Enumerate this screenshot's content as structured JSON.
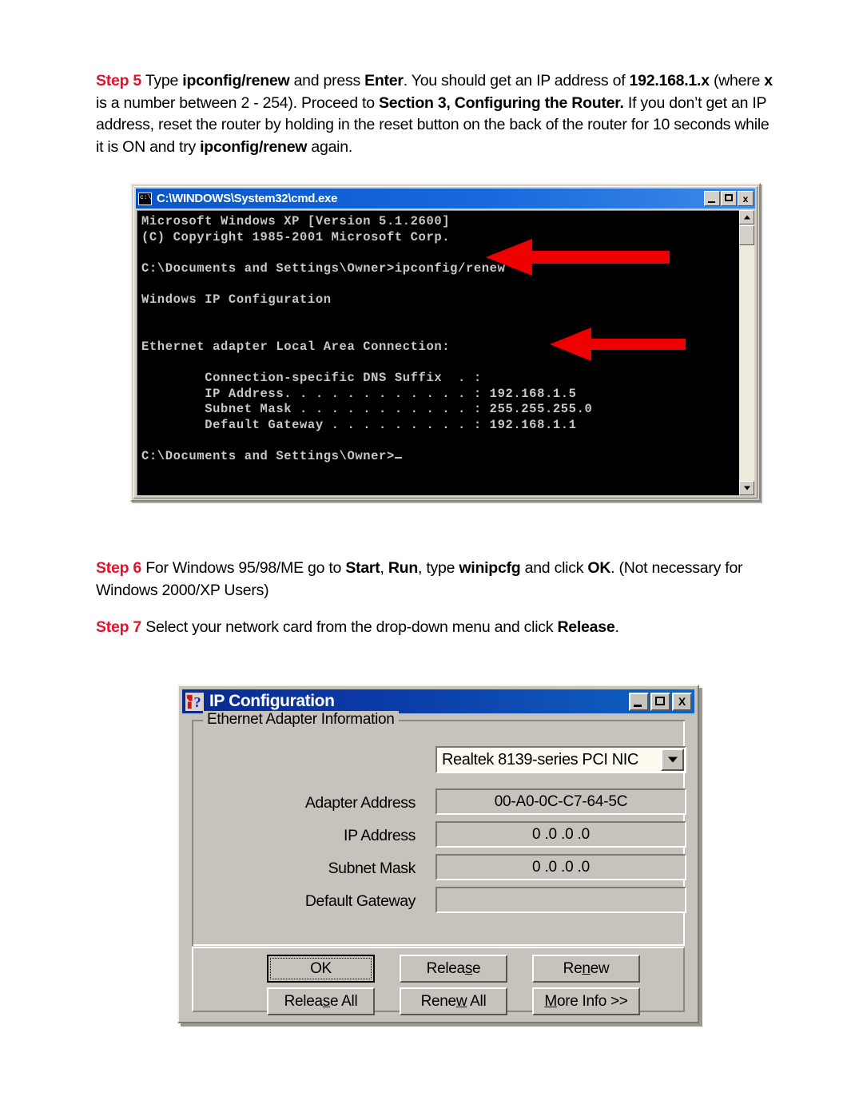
{
  "document": {
    "step5": {
      "label": "Step 5",
      "parts": [
        {
          "t": " Type ",
          "b": false
        },
        {
          "t": "ipconfig/renew",
          "b": true
        },
        {
          "t": " and press ",
          "b": false
        },
        {
          "t": "Enter",
          "b": true
        },
        {
          "t": ". You should get an IP address of ",
          "b": false
        },
        {
          "t": "192.168.1.x",
          "b": true
        },
        {
          "t": " (where ",
          "b": false
        },
        {
          "t": "x",
          "b": true
        },
        {
          "t": " is a number between 2 - 254). Proceed to ",
          "b": false
        },
        {
          "t": "Section 3, Configuring the Router.",
          "b": true
        },
        {
          "t": " If you don’t get an IP address, reset the router by holding in the reset button on the back of the router for 10 seconds while it is ON and try ",
          "b": false
        },
        {
          "t": "ipconfig/renew",
          "b": true
        },
        {
          "t": " again.",
          "b": false
        }
      ]
    },
    "step6": {
      "label": "Step 6",
      "parts": [
        {
          "t": " For Windows 95/98/ME go to ",
          "b": false
        },
        {
          "t": "Start",
          "b": true
        },
        {
          "t": ", ",
          "b": false
        },
        {
          "t": "Run",
          "b": true
        },
        {
          "t": ", type ",
          "b": false
        },
        {
          "t": "winipcfg",
          "b": true
        },
        {
          "t": " and click ",
          "b": false
        },
        {
          "t": "OK",
          "b": true
        },
        {
          "t": ".  (Not necessary for Windows 2000/XP Users)",
          "b": false
        }
      ]
    },
    "step7": {
      "label": "Step 7",
      "parts": [
        {
          "t": " Select your network card from the drop-down menu and click ",
          "b": false
        },
        {
          "t": "Release",
          "b": true
        },
        {
          "t": ".",
          "b": false
        }
      ]
    },
    "step_label_color": "#e8112d"
  },
  "cmd_window": {
    "title": "C:\\WINDOWS\\System32\\cmd.exe",
    "icon": "console-icon",
    "titlebar_color": "#1668dc",
    "screen_bg": "#000000",
    "screen_fg": "#c8c8c8",
    "buttons": {
      "minimize": "_",
      "maximize": "□",
      "close": "x"
    },
    "console_lines": [
      "Microsoft Windows XP [Version 5.1.2600]",
      "(C) Copyright 1985-2001 Microsoft Corp.",
      "",
      "C:\\Documents and Settings\\Owner>ipconfig/renew",
      "",
      "Windows IP Configuration",
      "",
      "",
      "Ethernet adapter Local Area Connection:",
      "",
      "        Connection-specific DNS Suffix  . :",
      "        IP Address. . . . . . . . . . . . : 192.168.1.5",
      "        Subnet Mask . . . . . . . . . . . : 255.255.255.0",
      "        Default Gateway . . . . . . . . . : 192.168.1.1",
      "",
      "C:\\Documents and Settings\\Owner>"
    ],
    "scrollbar": {
      "up_arrow": "scroll-up-arrow",
      "down_arrow": "scroll-down-arrow",
      "thumb": "scroll-thumb"
    }
  },
  "annotations": {
    "arrow_color": "#ee0000",
    "arrows": [
      {
        "name": "arrow-pointing-to-ipconfig-renew-command"
      },
      {
        "name": "arrow-pointing-to-ip-address"
      }
    ]
  },
  "ip_config_dialog": {
    "title": "IP Configuration",
    "icon": "question-mark-icon",
    "titlebar_color": "#0b3ba8",
    "buttons": {
      "minimize": "_",
      "maximize": "□",
      "close": "X"
    },
    "group_legend": "Ethernet  Adapter Information",
    "adapter_select": {
      "value": "Realtek 8139-series PCI NIC",
      "dropdown_icon": "chevron-down-icon"
    },
    "fields": [
      {
        "label": "Adapter Address",
        "value": "00-A0-0C-C7-64-5C"
      },
      {
        "label": "IP Address",
        "value": "0 .0 .0 .0"
      },
      {
        "label": "Subnet Mask",
        "value": "0 .0 .0 .0"
      },
      {
        "label": "Default Gateway",
        "value": ""
      }
    ],
    "action_buttons": [
      {
        "name": "ok",
        "pre": "",
        "mnemonic": "",
        "post": "OK",
        "default": true
      },
      {
        "name": "release",
        "pre": "Relea",
        "mnemonic": "s",
        "post": "e",
        "default": false
      },
      {
        "name": "renew",
        "pre": "Re",
        "mnemonic": "n",
        "post": "ew",
        "default": false
      },
      {
        "name": "release-all",
        "pre": "Relea",
        "mnemonic": "s",
        "post": "e All",
        "default": false
      },
      {
        "name": "renew-all",
        "pre": "Rene",
        "mnemonic": "w",
        "post": " All",
        "default": false
      },
      {
        "name": "more-info",
        "pre": "",
        "mnemonic": "M",
        "post": "ore Info >>",
        "default": false
      }
    ]
  }
}
